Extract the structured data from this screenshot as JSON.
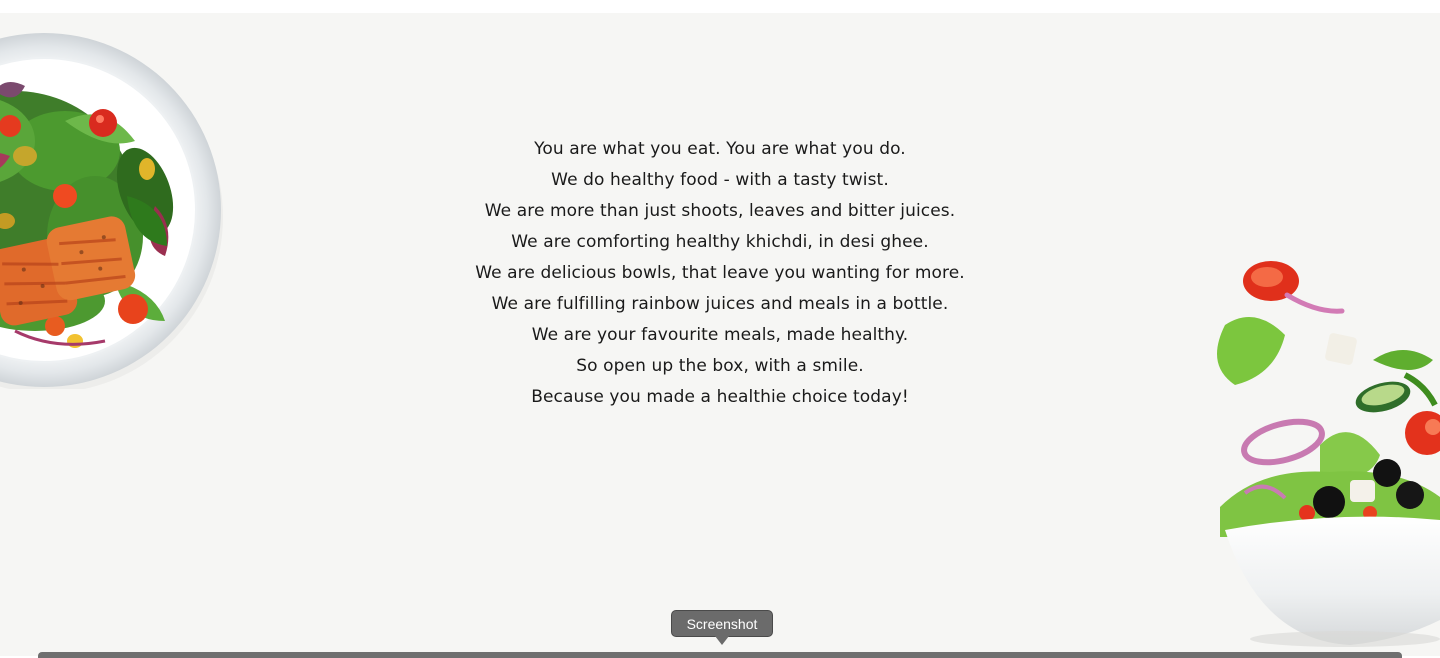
{
  "manifesto": {
    "lines": [
      "You are what you eat. You are what you do.",
      "We do healthy food - with a tasty twist.",
      "We are more than just shoots, leaves and bitter juices.",
      "We are comforting healthy khichdi, in desi ghee.",
      "We are delicious bowls, that leave you wanting for more.",
      "We are fulfilling rainbow juices and meals in a bottle.",
      "We are your favourite meals, made healthy.",
      "So open up the box, with a smile.",
      "Because you made a healthie choice today!"
    ]
  },
  "images": {
    "left": "salmon-salad-plate-image",
    "right": "tossed-salad-bowl-image"
  },
  "tooltip": {
    "label": "Screenshot"
  },
  "colors": {
    "background": "#f6f6f4",
    "text": "#1a1a1a",
    "tooltip_bg": "#6b6b6b"
  }
}
